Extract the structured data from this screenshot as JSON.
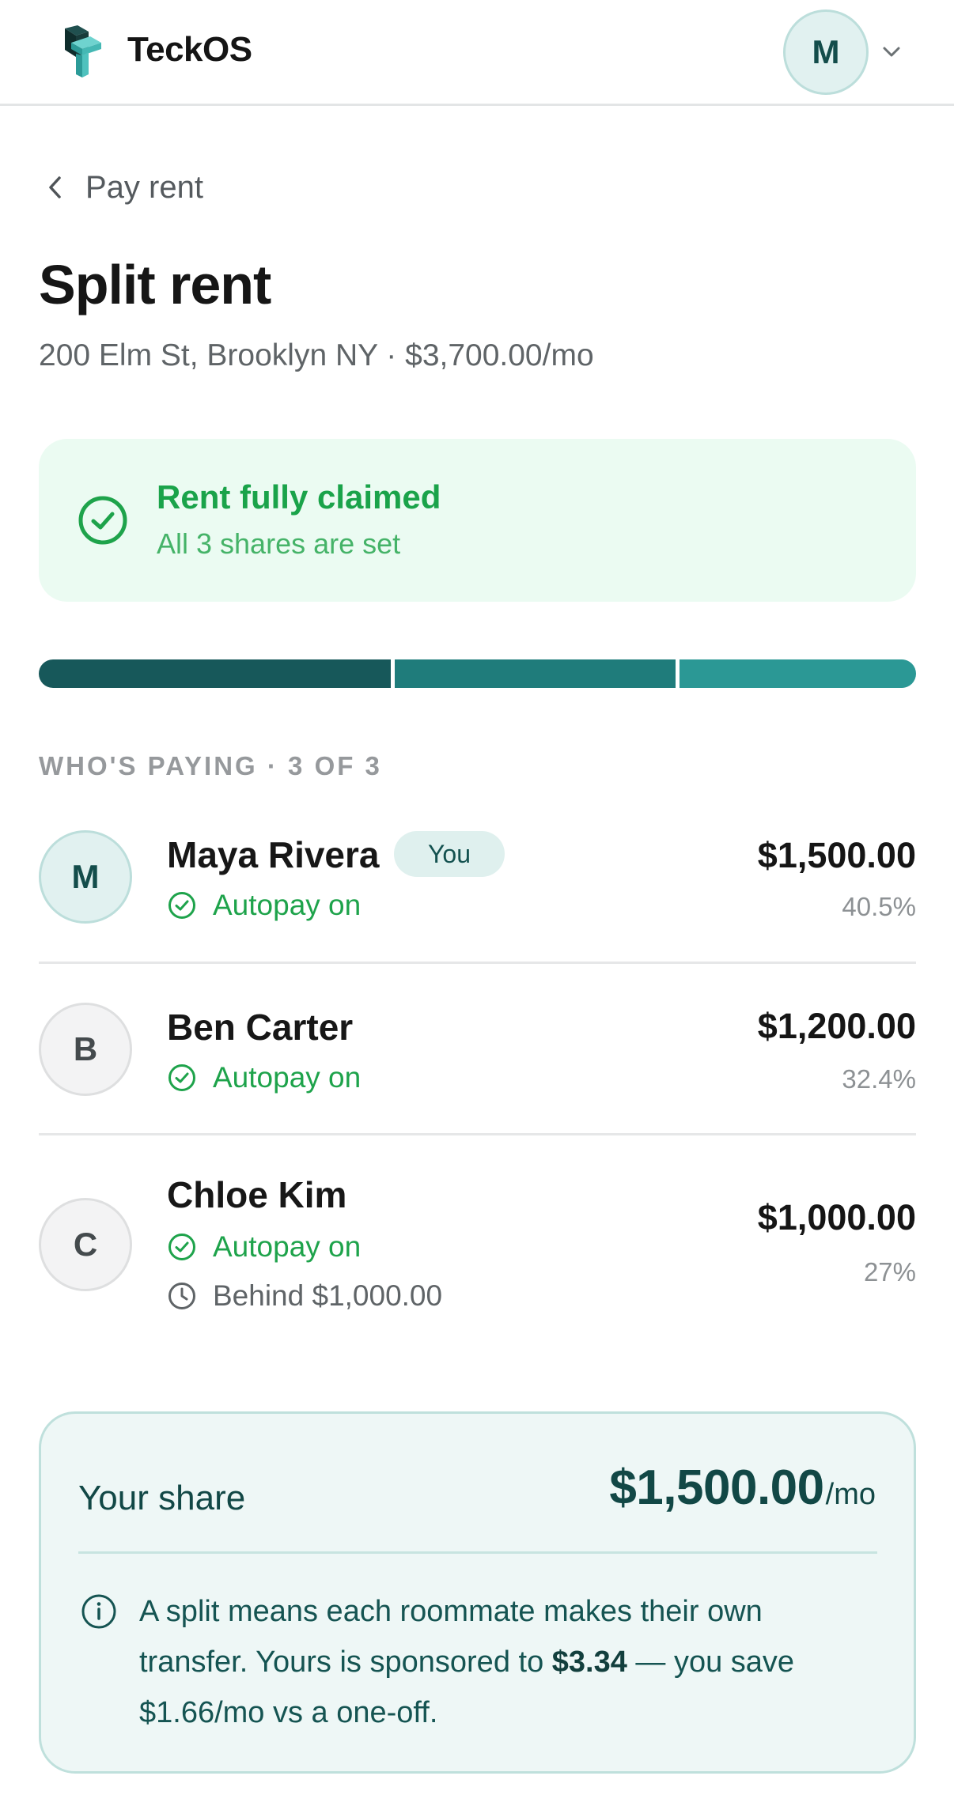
{
  "header": {
    "app_title": "TeckOS",
    "avatar_initial": "M",
    "logo_icon": "teckos-logo",
    "chevron_icon": "chevron-down-icon"
  },
  "nav": {
    "back_label": "Pay rent"
  },
  "page": {
    "title": "Split rent",
    "subtitle": "200 Elm St, Brooklyn NY · $3,700.00/mo"
  },
  "alert": {
    "title": "Rent fully claimed",
    "subtitle": "All 3 shares are set",
    "icon": "check-circle-icon"
  },
  "progress": {
    "segments": [
      {
        "share": 0.405,
        "color": "#17585a"
      },
      {
        "share": 0.324,
        "color": "#1f7c7b"
      },
      {
        "share": 0.27,
        "color": "#2b9895"
      }
    ]
  },
  "section": {
    "label": "WHO'S PAYING · 3 OF 3"
  },
  "roommates": [
    {
      "initial": "M",
      "name": "Maya Rivera",
      "badge": "You",
      "status": "Autopay on",
      "amount": "$1,500.00",
      "percent": "40.5%"
    },
    {
      "initial": "B",
      "name": "Ben Carter",
      "status": "Autopay on",
      "amount": "$1,200.00",
      "percent": "32.4%"
    },
    {
      "initial": "C",
      "name": "Chloe Kim",
      "status": "Autopay on",
      "warning": "Behind $1,000.00",
      "amount": "$1,000.00",
      "percent": "27%"
    }
  ],
  "share": {
    "label": "Your share",
    "amount": "$1,500.00",
    "unit": "/mo",
    "info_prefix": "A split means each roommate makes their own transfer. Yours is sponsored to ",
    "info_bold": "$3.34",
    "info_suffix": " — you save $1.66/mo vs a one-off.",
    "info_icon": "info-icon"
  },
  "colors": {
    "accent": "#124846",
    "success": "#1ea34b",
    "alert_bg": "#ebfbf2",
    "card_bg": "#eef7f6"
  }
}
